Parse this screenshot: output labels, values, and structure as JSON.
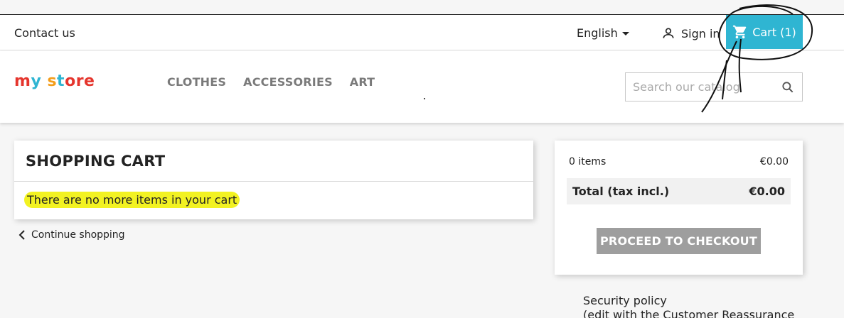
{
  "topbar": {
    "contact_label": "Contact us",
    "language_label": "English",
    "signin_label": "Sign in",
    "cart_label": "Cart (1)"
  },
  "header": {
    "logo_parts": [
      "m",
      "y",
      " s",
      "t",
      "ore"
    ],
    "menu": [
      "CLOTHES",
      "ACCESSORIES",
      "ART"
    ],
    "search_placeholder": "Search our catalog"
  },
  "cart": {
    "title": "SHOPPING CART",
    "empty_message": "There are no more items in your cart",
    "continue_label": "Continue shopping"
  },
  "summary": {
    "items_label": "0 items",
    "items_value": "€0.00",
    "total_label": "Total (tax incl.)",
    "total_value": "€0.00",
    "checkout_label": "PROCEED TO CHECKOUT"
  },
  "reassurance": {
    "line1": "Security policy",
    "line2": "(edit with the Customer Reassurance"
  },
  "colors": {
    "accent": "#2fb5d2",
    "highlight": "#f2f222",
    "checkout_disabled": "#9e9e9e"
  }
}
